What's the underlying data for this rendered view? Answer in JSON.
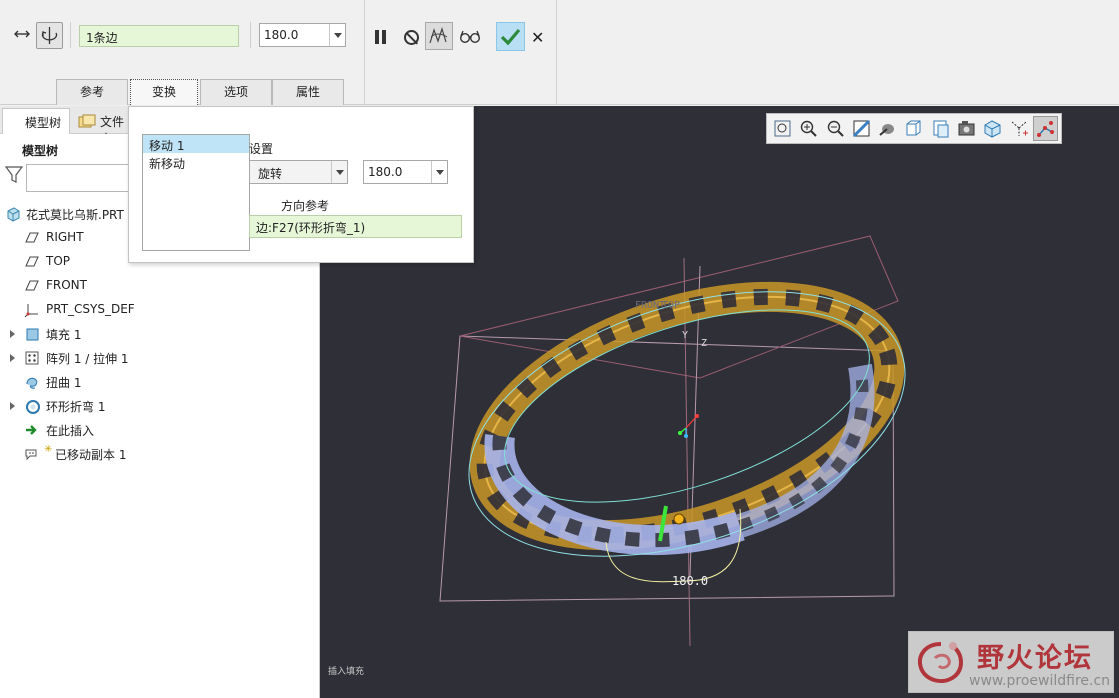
{
  "dashboard": {
    "edge_selection": "1条边",
    "angle_value": "180.0",
    "tabs": [
      "参考",
      "变换",
      "选项",
      "属性"
    ],
    "active_tab": "变换"
  },
  "model_tree": {
    "tab_model_tree": "模型树",
    "tab_folder": "文件夹",
    "title": "模型树",
    "root": "花式莫比乌斯.PRT",
    "items": [
      {
        "label": "RIGHT",
        "icon": "datum-plane-icon",
        "expandable": false
      },
      {
        "label": "TOP",
        "icon": "datum-plane-icon",
        "expandable": false
      },
      {
        "label": "FRONT",
        "icon": "datum-plane-icon",
        "expandable": false
      },
      {
        "label": "PRT_CSYS_DEF",
        "icon": "csys-icon",
        "expandable": false
      },
      {
        "label": "填充 1",
        "icon": "fill-icon",
        "expandable": true
      },
      {
        "label": "阵列 1 / 拉伸 1",
        "icon": "pattern-icon",
        "expandable": true
      },
      {
        "label": "扭曲 1",
        "icon": "warp-icon",
        "expandable": false
      },
      {
        "label": "环形折弯 1",
        "icon": "toroidal-bend-icon",
        "expandable": true
      },
      {
        "label": "在此插入",
        "icon": "insert-here-arrow-icon",
        "expandable": false
      },
      {
        "label": "已移动副本 1",
        "icon": "moved-copy-icon",
        "expandable": false
      }
    ]
  },
  "transform_panel": {
    "moves": [
      "移动 1",
      "新移动"
    ],
    "selected_move": "移动 1",
    "settings_label": "设置",
    "type": "旋转",
    "angle": "180.0",
    "direction_ref_label": "方向参考",
    "direction_ref": "边:F27(环形折弯_1)"
  },
  "viewport": {
    "dimension_label": "180.0",
    "datum_labels": [
      "FRONT",
      "TOP",
      "Y",
      "Z"
    ],
    "status_text": "插入填充"
  },
  "watermark": {
    "title": "野火论坛",
    "url": "www.proewildfire.cn"
  }
}
